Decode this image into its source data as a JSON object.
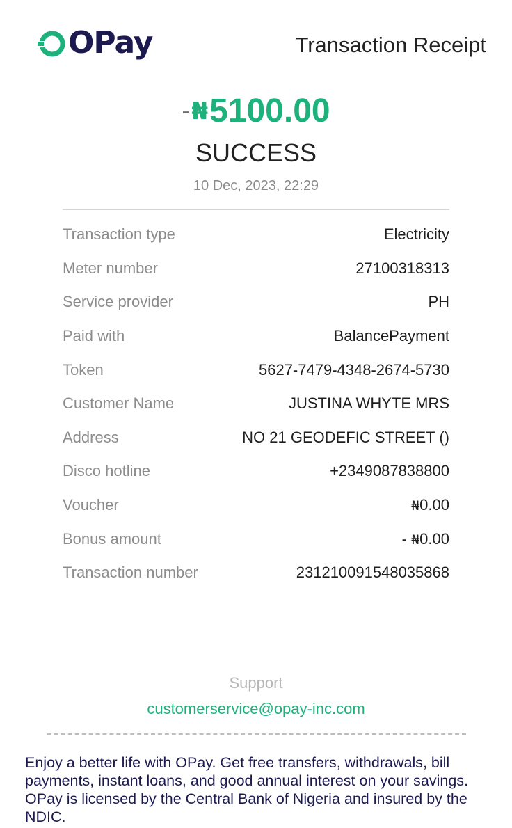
{
  "header": {
    "brand": "OPay",
    "brand_colors": {
      "ring": "#1db27c",
      "text": "#1c1a4f"
    },
    "title": "Transaction Receipt"
  },
  "summary": {
    "sign": "-",
    "currency": "₦",
    "amount": "5100.00",
    "status": "SUCCESS",
    "datetime": "10 Dec, 2023, 22:29",
    "accent_color": "#1db27c"
  },
  "details": [
    {
      "label": "Transaction type",
      "value": "Electricity"
    },
    {
      "label": "Meter number",
      "value": "27100318313"
    },
    {
      "label": "Service provider",
      "value": "PH"
    },
    {
      "label": "Paid with",
      "value": "BalancePayment"
    },
    {
      "label": "Token",
      "value": "5627-7479-4348-2674-5730"
    },
    {
      "label": "Customer Name",
      "value": "JUSTINA WHYTE MRS"
    },
    {
      "label": "Address",
      "value": "NO 21 GEODEFIC STREET ()"
    },
    {
      "label": "Disco hotline",
      "value": "+2349087838800"
    },
    {
      "label": "Voucher",
      "value_prefix": "",
      "currency": "₦",
      "value": "0.00"
    },
    {
      "label": "Bonus amount",
      "value_prefix": "- ",
      "currency": "₦",
      "value": "0.00"
    },
    {
      "label": "Transaction number",
      "value": "231210091548035868"
    }
  ],
  "support": {
    "label": "Support",
    "email": "customerservice@opay-inc.com"
  },
  "footer": {
    "text": "Enjoy a better life with OPay. Get free transfers, withdrawals, bill payments, instant loans, and good annual interest on your savings. OPay is licensed by the Central Bank of Nigeria and insured by the NDIC."
  }
}
